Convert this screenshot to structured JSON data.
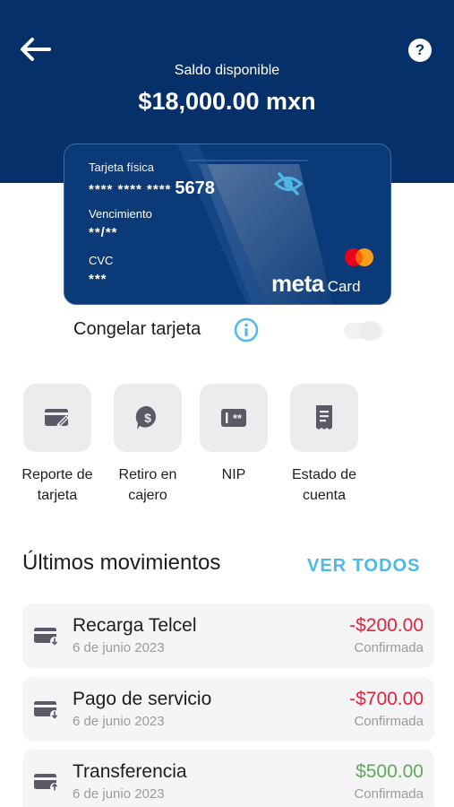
{
  "header": {
    "balance_label": "Saldo disponible",
    "balance_amount": "$18,000.00 mxn",
    "back_icon": "arrow-left-icon",
    "help_icon": "question-icon",
    "help_glyph": "?"
  },
  "card": {
    "type_label": "Tarjeta física",
    "masked_number": "**** **** ****",
    "last4": "5678",
    "expiry_label": "Vencimiento",
    "expiry_value": "**/**",
    "cvc_label": "CVC",
    "cvc_value": "***",
    "brand_meta": "meta",
    "brand_card": "Card",
    "visibility_icon": "eye-off-icon",
    "network_icon": "mastercard-logo"
  },
  "freeze": {
    "label": "Congelar tarjeta",
    "info_icon": "info-icon",
    "enabled": false
  },
  "actions": [
    {
      "label": "Reporte de tarjeta",
      "icon": "card-edit-icon"
    },
    {
      "label": "Retiro en cajero",
      "icon": "cash-icon"
    },
    {
      "label": "NIP",
      "icon": "pin-icon"
    },
    {
      "label": "Estado de cuenta",
      "icon": "receipt-icon"
    }
  ],
  "movements": {
    "title": "Últimos movimientos",
    "view_all": "VER TODOS",
    "items": [
      {
        "name": "Recarga Telcel",
        "date": "6 de junio 2023",
        "amount": "-$200.00",
        "status": "Confirmada",
        "type": "debit"
      },
      {
        "name": "Pago de servicio",
        "date": "6 de junio 2023",
        "amount": "-$700.00",
        "status": "Confirmada",
        "type": "debit"
      },
      {
        "name": "Transferencia",
        "date": "6 de junio 2023",
        "amount": "$500.00",
        "status": "Confirmada",
        "type": "credit"
      }
    ]
  },
  "colors": {
    "header_bg": "#06306a",
    "card_bg": "#0a3a78",
    "accent": "#4fb8e6",
    "debit": "#e0263a",
    "credit": "#5eaa55"
  }
}
